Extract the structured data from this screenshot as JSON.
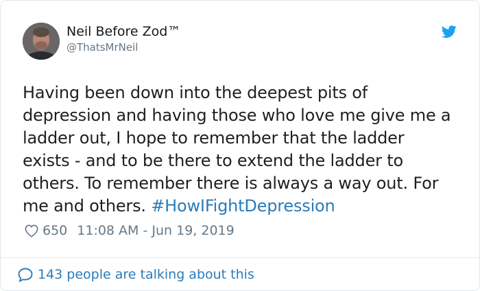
{
  "author": {
    "display_name": "Neil Before Zod™",
    "handle": "@ThatsMrNeil",
    "avatar_icon": "profile-photo"
  },
  "tweet": {
    "lines": [
      "Having been down into the deepest pits of",
      "depression and having those who love me give me a",
      "ladder out, I hope to remember that the ladder",
      "exists - and to be there to extend the ladder to",
      "others. To remember there is always a way out. For"
    ],
    "last_line": "me and others.",
    "hashtag": "#HowIFightDepression"
  },
  "meta": {
    "like_count": "650",
    "timestamp": "11:08 AM - Jun 19, 2019"
  },
  "footer": {
    "talking_text": "143 people are talking about this"
  },
  "icons": {
    "brand": "twitter-bird-icon",
    "like": "heart-icon",
    "reply": "speech-bubble-icon"
  },
  "colors": {
    "twitter_blue": "#1da1f2",
    "link": "#2b7bb9",
    "text": "#1c2022",
    "muted": "#657786"
  }
}
